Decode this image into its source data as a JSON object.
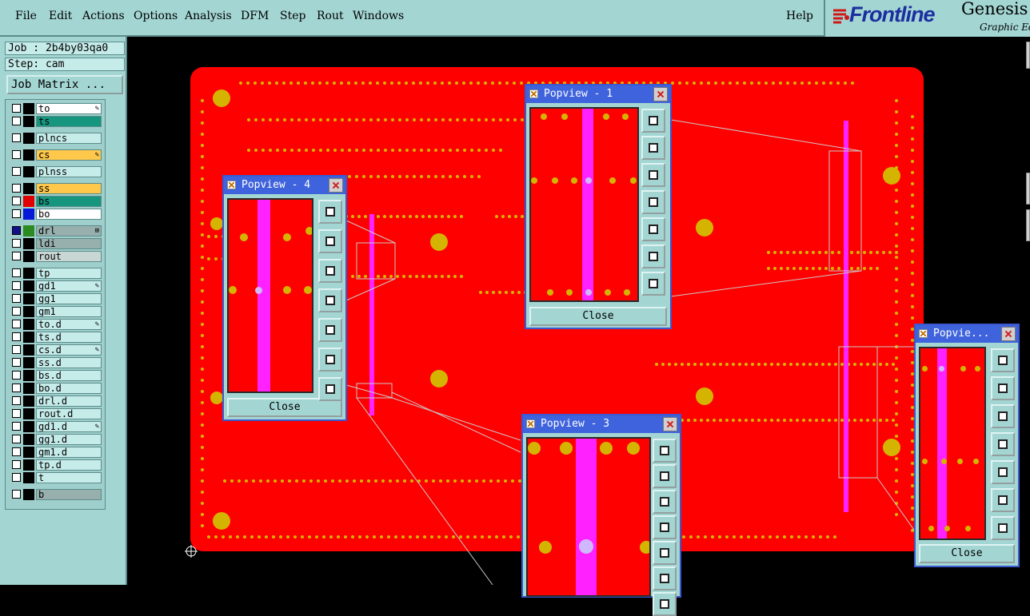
{
  "menu": {
    "file": "File",
    "edit": "Edit",
    "actions": "Actions",
    "options": "Options",
    "analysis": "Analysis",
    "dfm": "DFM",
    "step": "Step",
    "rout": "Rout",
    "windows": "Windows",
    "help": "Help"
  },
  "logo": {
    "frontline": "Frontline",
    "genesis": "Genesis",
    "graphic": "Graphic Ed"
  },
  "job": {
    "job_label": "Job : 2b4by03qa0",
    "step_label": "Step: cam",
    "job_matrix_button": "Job Matrix ..."
  },
  "layers": [
    {
      "name": "to",
      "color": "#000000",
      "bg": "#ffffff",
      "mark": "✎",
      "on": false
    },
    {
      "name": "ts",
      "color": "#000000",
      "bg": "#16967e",
      "mark": "",
      "on": false
    },
    {
      "name": "plncs",
      "color": "#000000",
      "bg": "#c6ecea",
      "mark": "",
      "on": false
    },
    {
      "name": "cs",
      "color": "#000000",
      "bg": "#ffc84a",
      "mark": "✎",
      "on": false
    },
    {
      "name": "plnss",
      "color": "#000000",
      "bg": "#c6ecea",
      "mark": "",
      "on": false
    },
    {
      "name": "ss",
      "color": "#000000",
      "bg": "#ffc84a",
      "mark": "",
      "on": false
    },
    {
      "name": "bs",
      "color": "#e00000",
      "bg": "#16967e",
      "mark": "",
      "on": false
    },
    {
      "name": "bo",
      "color": "#0818d8",
      "bg": "#ffffff",
      "mark": "",
      "on": false
    },
    {
      "name": "drl",
      "color": "#2b8a20",
      "bg": "#97b0ae",
      "mark": "⊞",
      "on": true
    },
    {
      "name": "ldi",
      "color": "#000000",
      "bg": "#97b0ae",
      "mark": "",
      "on": false
    },
    {
      "name": "rout",
      "color": "#000000",
      "bg": "#c8d6d4",
      "mark": "",
      "on": false
    },
    {
      "name": "tp",
      "color": "#000000",
      "bg": "#c6ecea",
      "mark": "",
      "on": false
    },
    {
      "name": "gd1",
      "color": "#000000",
      "bg": "#c6ecea",
      "mark": "✎",
      "on": false
    },
    {
      "name": "gg1",
      "color": "#000000",
      "bg": "#c6ecea",
      "mark": "",
      "on": false
    },
    {
      "name": "gm1",
      "color": "#000000",
      "bg": "#c6ecea",
      "mark": "",
      "on": false
    },
    {
      "name": "to.d",
      "color": "#000000",
      "bg": "#c6ecea",
      "mark": "✎",
      "on": false
    },
    {
      "name": "ts.d",
      "color": "#000000",
      "bg": "#c6ecea",
      "mark": "",
      "on": false
    },
    {
      "name": "cs.d",
      "color": "#000000",
      "bg": "#c6ecea",
      "mark": "✎",
      "on": false
    },
    {
      "name": "ss.d",
      "color": "#000000",
      "bg": "#c6ecea",
      "mark": "",
      "on": false
    },
    {
      "name": "bs.d",
      "color": "#000000",
      "bg": "#c6ecea",
      "mark": "",
      "on": false
    },
    {
      "name": "bo.d",
      "color": "#000000",
      "bg": "#c6ecea",
      "mark": "",
      "on": false
    },
    {
      "name": "drl.d",
      "color": "#000000",
      "bg": "#c6ecea",
      "mark": "",
      "on": false
    },
    {
      "name": "rout.d",
      "color": "#000000",
      "bg": "#c6ecea",
      "mark": "",
      "on": false
    },
    {
      "name": "gd1.d",
      "color": "#000000",
      "bg": "#c6ecea",
      "mark": "✎",
      "on": false
    },
    {
      "name": "gg1.d",
      "color": "#000000",
      "bg": "#c6ecea",
      "mark": "",
      "on": false
    },
    {
      "name": "gm1.d",
      "color": "#000000",
      "bg": "#c6ecea",
      "mark": "",
      "on": false
    },
    {
      "name": "tp.d",
      "color": "#000000",
      "bg": "#c6ecea",
      "mark": "",
      "on": false
    },
    {
      "name": "t",
      "color": "#000000",
      "bg": "#c6ecea",
      "mark": "",
      "on": false
    },
    {
      "name": "b",
      "color": "#000000",
      "bg": "#97b0ae",
      "mark": "",
      "on": false
    }
  ],
  "popviews": {
    "p1": {
      "title": "Popview - 1",
      "close_label": "Close"
    },
    "p3": {
      "title": "Popview - 3",
      "close_label": "Close"
    },
    "p4": {
      "title": "Popview - 4",
      "close_label": "Close"
    },
    "p5": {
      "title": "Popvie...",
      "close_label": "Close"
    }
  },
  "tool_icons": [
    "zoom-home-icon",
    "pan-up-icon",
    "pan-down-icon",
    "pan-left-icon",
    "pan-right-icon",
    "zoom-in-icon",
    "zoom-out-icon"
  ],
  "colors": {
    "panel": "#a3d6d3",
    "board": "#ff0000",
    "trace": "#ff22ff",
    "pad": "#d4b400",
    "titlebar": "#3f63dc"
  }
}
